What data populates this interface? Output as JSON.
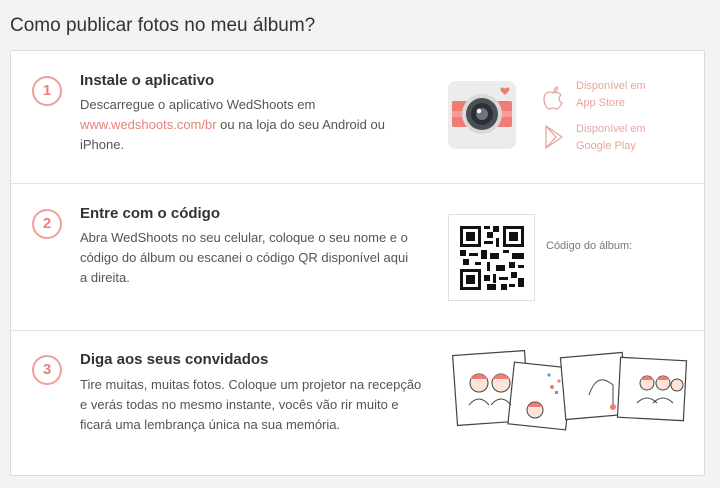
{
  "page": {
    "title": "Como publicar fotos no meu álbum?"
  },
  "steps": [
    {
      "number": "1",
      "title": "Instale o aplicativo",
      "text_before": "Descarregue o aplicativo WedShoots em",
      "link": "www.wedshoots.com/br",
      "text_after": " ou na loja do seu Android ou iPhone."
    },
    {
      "number": "2",
      "title": "Entre com o código",
      "text": "Abra WedShoots no seu celular, coloque o seu nome e o código do álbum ou escanei o código QR disponível aqui a direita."
    },
    {
      "number": "3",
      "title": "Diga aos seus convidados",
      "text": "Tire muitas, muitas fotos. Coloque um projetor na recepção e verás todas no mesmo instante, vocês vão rir muito e ficará uma lembrança única na sua memória."
    }
  ],
  "stores": {
    "apple": {
      "line1": "Disponível em",
      "line2": "App Store",
      "icon": "apple-icon"
    },
    "google": {
      "line1": "Disponível em",
      "line2": "Google Play",
      "icon": "play-store-icon"
    }
  },
  "qr": {
    "label": "Código do álbum:"
  },
  "colors": {
    "accent": "#e8827a",
    "accent_light": "#f0a09a"
  }
}
